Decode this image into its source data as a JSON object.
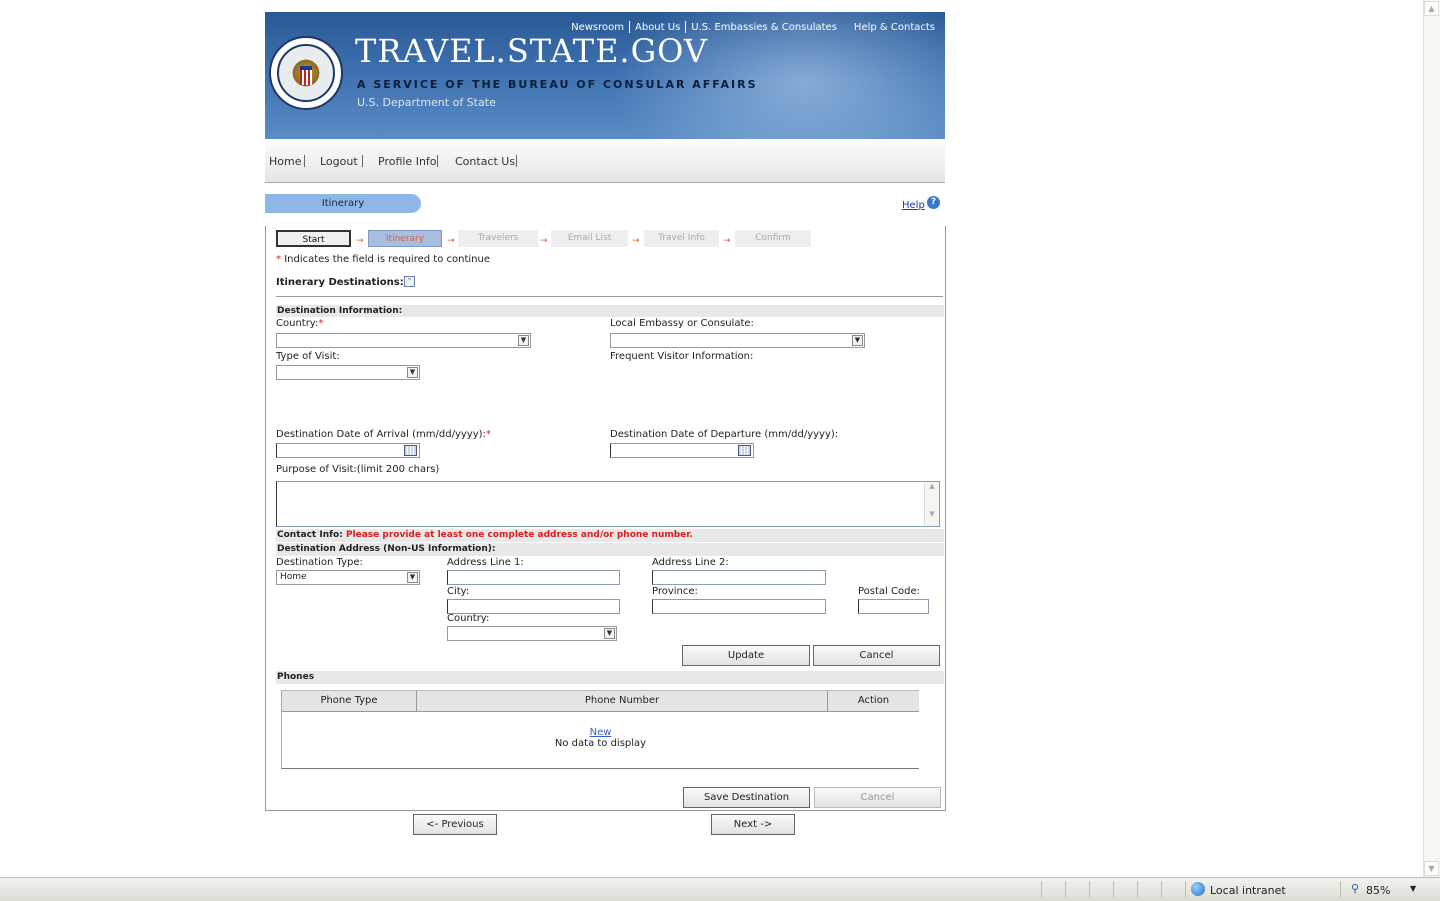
{
  "header": {
    "toplinks": [
      "Newsroom",
      "About Us",
      "U.S. Embassies & Consulates",
      "Help & Contacts"
    ],
    "title": "TRAVEL.STATE.GOV",
    "subtitle": "A SERVICE OF THE BUREAU OF CONSULAR AFFAIRS",
    "department": "U.S. Department of State"
  },
  "nav": {
    "items": [
      "Home",
      "Logout",
      "Profile Info",
      "Contact Us"
    ]
  },
  "page": {
    "tab_label": "Itinerary",
    "help_label": "Help",
    "help_icon": "?"
  },
  "steps": [
    "Start",
    "Itinerary",
    "Travelers",
    "Email List",
    "Travel Info",
    "Confirm"
  ],
  "required_note": "Indicates the field is required to continue",
  "required_star": "*",
  "section_title": "Itinerary Destinations:",
  "destination": {
    "heading": "Destination Information:",
    "country_label": "Country:",
    "embassy_label": "Local Embassy or Consulate:",
    "visit_type_label": "Type of Visit:",
    "frequent_label": "Frequent Visitor Information:",
    "arrival_label": "Destination Date of Arrival (mm/dd/yyyy):",
    "departure_label": "Destination Date of Departure (mm/dd/yyyy):",
    "purpose_label": "Purpose of Visit:(limit 200 chars)"
  },
  "contact": {
    "label": "Contact Info:",
    "warning": "Please provide at least one complete address and/or phone number.",
    "address_heading": "Destination Address (Non-US Information):",
    "dest_type_label": "Destination Type:",
    "dest_type_value": "Home",
    "address1_label": "Address Line 1:",
    "address2_label": "Address Line 2:",
    "city_label": "City:",
    "province_label": "Province:",
    "postal_label": "Postal Code:",
    "country_label": "Country:",
    "update_button": "Update",
    "cancel_button": "Cancel"
  },
  "phones": {
    "heading": "Phones",
    "columns": [
      "Phone Type",
      "Phone Number",
      "Action"
    ],
    "new_link": "New",
    "empty_text": "No data to display"
  },
  "footer_buttons": {
    "save": "Save Destination",
    "cancel": "Cancel",
    "previous": "<- Previous",
    "next": "Next ->"
  },
  "statusbar": {
    "zone": "Local intranet",
    "zoom": "85%"
  },
  "colors": {
    "header_blue": "#3d6fae",
    "tab_blue": "#8fb7e6",
    "active_step_text": "#d06640",
    "required_red": "#d62020",
    "link_blue": "#1a3aa8"
  }
}
